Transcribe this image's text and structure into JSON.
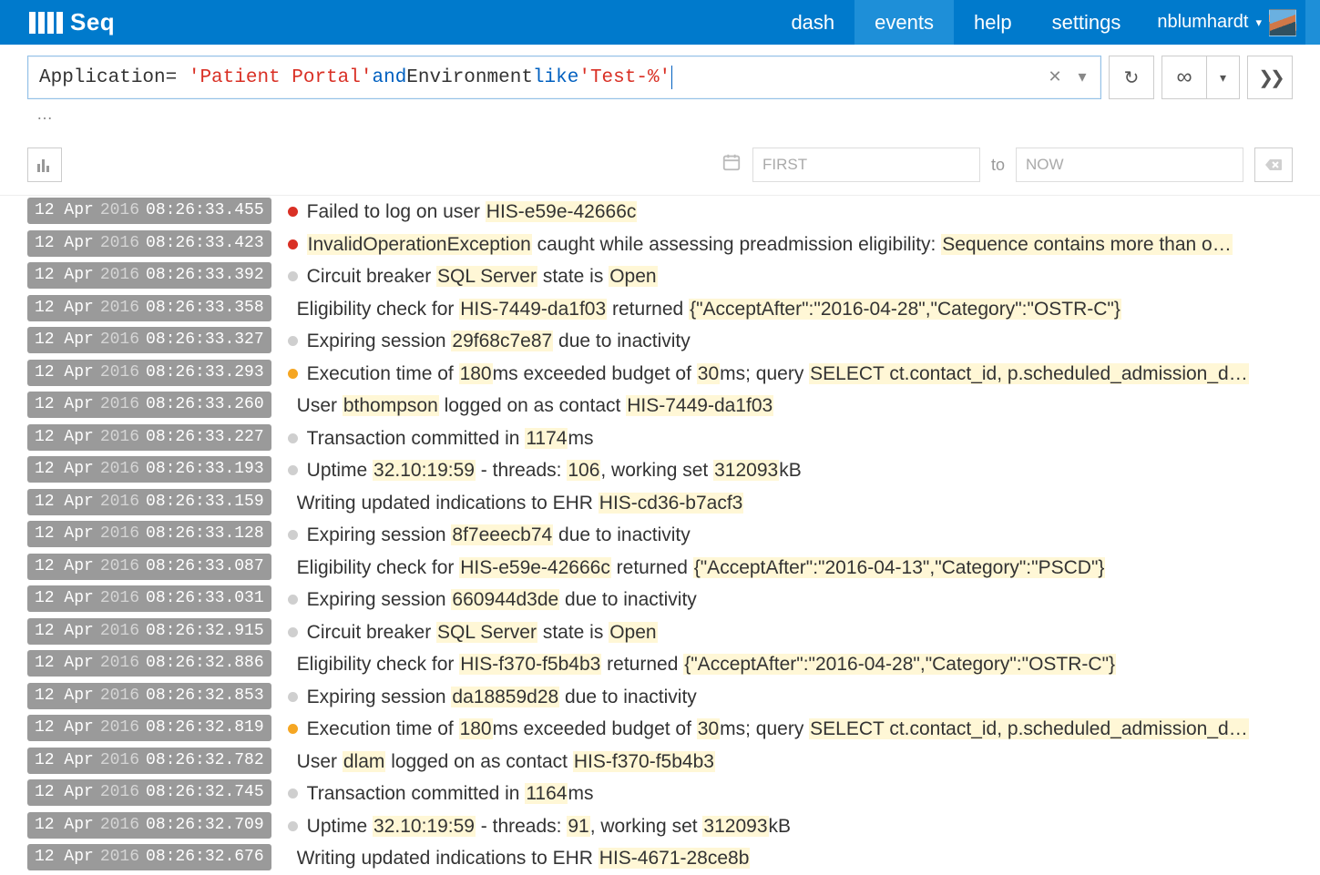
{
  "brand": "Seq",
  "nav": {
    "dash": "dash",
    "events": "events",
    "help": "help",
    "settings": "settings",
    "user": "nblumhardt"
  },
  "query": {
    "parts": [
      {
        "t": "ident",
        "v": "Application"
      },
      {
        "t": "sp",
        "v": " "
      },
      {
        "t": "plain",
        "v": "= "
      },
      {
        "t": "str",
        "v": "'Patient Portal'"
      },
      {
        "t": "sp",
        "v": " "
      },
      {
        "t": "op",
        "v": "and"
      },
      {
        "t": "sp",
        "v": " "
      },
      {
        "t": "ident",
        "v": "Environment"
      },
      {
        "t": "sp",
        "v": " "
      },
      {
        "t": "op",
        "v": "like"
      },
      {
        "t": "sp",
        "v": " "
      },
      {
        "t": "str",
        "v": "'Test-%'"
      }
    ],
    "clear_title": "Clear",
    "dropdown_title": "More",
    "refresh_title": "↻",
    "tail_title": "∞",
    "expand_title": "››"
  },
  "ellipsis": "…",
  "filters": {
    "first_placeholder": "FIRST",
    "to_label": "to",
    "now_placeholder": "NOW"
  },
  "levels": {
    "error": "error",
    "info": "info",
    "warn": "warn",
    "none": "none"
  },
  "events": [
    {
      "date": "12 Apr",
      "year": "2016",
      "time": "08:26:33.455",
      "lvl": "error",
      "segs": [
        {
          "t": "p",
          "v": "Failed to log on user "
        },
        {
          "t": "h",
          "v": "HIS-e59e-42666c"
        }
      ]
    },
    {
      "date": "12 Apr",
      "year": "2016",
      "time": "08:26:33.423",
      "lvl": "error",
      "segs": [
        {
          "t": "h",
          "v": "InvalidOperationException"
        },
        {
          "t": "p",
          "v": " caught while assessing preadmission eligibility: "
        },
        {
          "t": "h",
          "v": "Sequence contains more than o…"
        }
      ]
    },
    {
      "date": "12 Apr",
      "year": "2016",
      "time": "08:26:33.392",
      "lvl": "info",
      "segs": [
        {
          "t": "p",
          "v": "Circuit breaker "
        },
        {
          "t": "h",
          "v": "SQL Server"
        },
        {
          "t": "p",
          "v": " state is "
        },
        {
          "t": "h",
          "v": "Open"
        }
      ]
    },
    {
      "date": "12 Apr",
      "year": "2016",
      "time": "08:26:33.358",
      "lvl": "none",
      "segs": [
        {
          "t": "p",
          "v": "Eligibility check for "
        },
        {
          "t": "h",
          "v": "HIS-7449-da1f03"
        },
        {
          "t": "p",
          "v": " returned "
        },
        {
          "t": "h",
          "v": "{\"AcceptAfter\":\"2016-04-28\",\"Category\":\"OSTR-C\"}"
        }
      ]
    },
    {
      "date": "12 Apr",
      "year": "2016",
      "time": "08:26:33.327",
      "lvl": "info",
      "segs": [
        {
          "t": "p",
          "v": "Expiring session "
        },
        {
          "t": "h",
          "v": "29f68c7e87"
        },
        {
          "t": "p",
          "v": " due to inactivity"
        }
      ]
    },
    {
      "date": "12 Apr",
      "year": "2016",
      "time": "08:26:33.293",
      "lvl": "warn",
      "segs": [
        {
          "t": "p",
          "v": "Execution time of "
        },
        {
          "t": "h",
          "v": "180"
        },
        {
          "t": "p",
          "v": "ms exceeded budget of "
        },
        {
          "t": "h",
          "v": "30"
        },
        {
          "t": "p",
          "v": "ms; query "
        },
        {
          "t": "h",
          "v": "SELECT ct.contact_id, p.scheduled_admission_d…"
        }
      ]
    },
    {
      "date": "12 Apr",
      "year": "2016",
      "time": "08:26:33.260",
      "lvl": "none",
      "segs": [
        {
          "t": "p",
          "v": "User "
        },
        {
          "t": "h",
          "v": "bthompson"
        },
        {
          "t": "p",
          "v": " logged on as contact "
        },
        {
          "t": "h",
          "v": "HIS-7449-da1f03"
        }
      ]
    },
    {
      "date": "12 Apr",
      "year": "2016",
      "time": "08:26:33.227",
      "lvl": "info",
      "segs": [
        {
          "t": "p",
          "v": "Transaction committed in "
        },
        {
          "t": "h",
          "v": "1174"
        },
        {
          "t": "p",
          "v": "ms"
        }
      ]
    },
    {
      "date": "12 Apr",
      "year": "2016",
      "time": "08:26:33.193",
      "lvl": "info",
      "segs": [
        {
          "t": "p",
          "v": "Uptime "
        },
        {
          "t": "h",
          "v": "32.10:19:59"
        },
        {
          "t": "p",
          "v": " - threads: "
        },
        {
          "t": "h",
          "v": "106"
        },
        {
          "t": "p",
          "v": ", working set "
        },
        {
          "t": "h",
          "v": "312093"
        },
        {
          "t": "p",
          "v": "kB"
        }
      ]
    },
    {
      "date": "12 Apr",
      "year": "2016",
      "time": "08:26:33.159",
      "lvl": "none",
      "segs": [
        {
          "t": "p",
          "v": "Writing updated indications to EHR "
        },
        {
          "t": "h",
          "v": "HIS-cd36-b7acf3"
        }
      ]
    },
    {
      "date": "12 Apr",
      "year": "2016",
      "time": "08:26:33.128",
      "lvl": "info",
      "segs": [
        {
          "t": "p",
          "v": "Expiring session "
        },
        {
          "t": "h",
          "v": "8f7eeecb74"
        },
        {
          "t": "p",
          "v": " due to inactivity"
        }
      ]
    },
    {
      "date": "12 Apr",
      "year": "2016",
      "time": "08:26:33.087",
      "lvl": "none",
      "segs": [
        {
          "t": "p",
          "v": "Eligibility check for "
        },
        {
          "t": "h",
          "v": "HIS-e59e-42666c"
        },
        {
          "t": "p",
          "v": " returned "
        },
        {
          "t": "h",
          "v": "{\"AcceptAfter\":\"2016-04-13\",\"Category\":\"PSCD\"}"
        }
      ]
    },
    {
      "date": "12 Apr",
      "year": "2016",
      "time": "08:26:33.031",
      "lvl": "info",
      "segs": [
        {
          "t": "p",
          "v": "Expiring session "
        },
        {
          "t": "h",
          "v": "660944d3de"
        },
        {
          "t": "p",
          "v": " due to inactivity"
        }
      ]
    },
    {
      "date": "12 Apr",
      "year": "2016",
      "time": "08:26:32.915",
      "lvl": "info",
      "segs": [
        {
          "t": "p",
          "v": "Circuit breaker "
        },
        {
          "t": "h",
          "v": "SQL Server"
        },
        {
          "t": "p",
          "v": " state is "
        },
        {
          "t": "h",
          "v": "Open"
        }
      ]
    },
    {
      "date": "12 Apr",
      "year": "2016",
      "time": "08:26:32.886",
      "lvl": "none",
      "segs": [
        {
          "t": "p",
          "v": "Eligibility check for "
        },
        {
          "t": "h",
          "v": "HIS-f370-f5b4b3"
        },
        {
          "t": "p",
          "v": " returned "
        },
        {
          "t": "h",
          "v": "{\"AcceptAfter\":\"2016-04-28\",\"Category\":\"OSTR-C\"}"
        }
      ]
    },
    {
      "date": "12 Apr",
      "year": "2016",
      "time": "08:26:32.853",
      "lvl": "info",
      "segs": [
        {
          "t": "p",
          "v": "Expiring session "
        },
        {
          "t": "h",
          "v": "da18859d28"
        },
        {
          "t": "p",
          "v": " due to inactivity"
        }
      ]
    },
    {
      "date": "12 Apr",
      "year": "2016",
      "time": "08:26:32.819",
      "lvl": "warn",
      "segs": [
        {
          "t": "p",
          "v": "Execution time of "
        },
        {
          "t": "h",
          "v": "180"
        },
        {
          "t": "p",
          "v": "ms exceeded budget of "
        },
        {
          "t": "h",
          "v": "30"
        },
        {
          "t": "p",
          "v": "ms; query "
        },
        {
          "t": "h",
          "v": "SELECT ct.contact_id, p.scheduled_admission_d…"
        }
      ]
    },
    {
      "date": "12 Apr",
      "year": "2016",
      "time": "08:26:32.782",
      "lvl": "none",
      "segs": [
        {
          "t": "p",
          "v": "User "
        },
        {
          "t": "h",
          "v": "dlam"
        },
        {
          "t": "p",
          "v": " logged on as contact "
        },
        {
          "t": "h",
          "v": "HIS-f370-f5b4b3"
        }
      ]
    },
    {
      "date": "12 Apr",
      "year": "2016",
      "time": "08:26:32.745",
      "lvl": "info",
      "segs": [
        {
          "t": "p",
          "v": "Transaction committed in "
        },
        {
          "t": "h",
          "v": "1164"
        },
        {
          "t": "p",
          "v": "ms"
        }
      ]
    },
    {
      "date": "12 Apr",
      "year": "2016",
      "time": "08:26:32.709",
      "lvl": "info",
      "segs": [
        {
          "t": "p",
          "v": "Uptime "
        },
        {
          "t": "h",
          "v": "32.10:19:59"
        },
        {
          "t": "p",
          "v": " - threads: "
        },
        {
          "t": "h",
          "v": "91"
        },
        {
          "t": "p",
          "v": ", working set "
        },
        {
          "t": "h",
          "v": "312093"
        },
        {
          "t": "p",
          "v": "kB"
        }
      ]
    },
    {
      "date": "12 Apr",
      "year": "2016",
      "time": "08:26:32.676",
      "lvl": "none",
      "segs": [
        {
          "t": "p",
          "v": "Writing updated indications to EHR "
        },
        {
          "t": "h",
          "v": "HIS-4671-28ce8b"
        }
      ]
    }
  ]
}
